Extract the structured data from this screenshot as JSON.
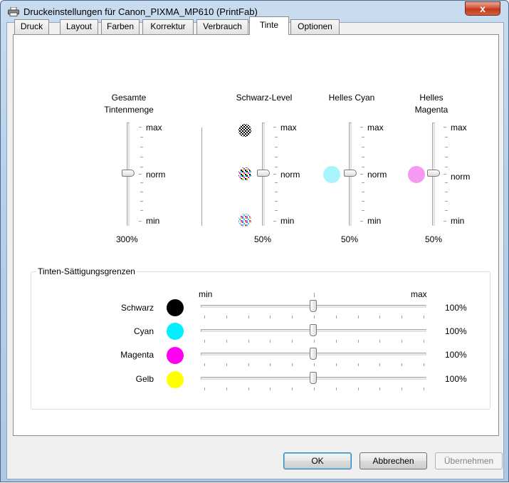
{
  "window": {
    "title": "Druckeinstellungen für Canon_PIXMA_MP610 (PrintFab)",
    "close_glyph": "x"
  },
  "tabs": [
    {
      "label": "Druck",
      "active": false
    },
    {
      "label": "Layout",
      "active": false
    },
    {
      "label": "Farben",
      "active": false
    },
    {
      "label": "Korrektur",
      "active": false
    },
    {
      "label": "Verbrauch",
      "active": false
    },
    {
      "label": "Tinte",
      "active": true
    },
    {
      "label": "Optionen",
      "active": false
    }
  ],
  "scale_labels": {
    "max": "max",
    "norm": "norm",
    "min": "min"
  },
  "vertical_sliders": [
    {
      "title_line1": "Gesamte",
      "title_line2": "Tintenmenge",
      "value_text": "300%",
      "level": 0.5
    },
    {
      "title_line1": "Schwarz-Level",
      "title_line2": "",
      "value_text": "50%",
      "level": 0.5
    },
    {
      "title_line1": "Helles Cyan",
      "title_line2": "",
      "value_text": "50%",
      "level": 0.5,
      "swatch_color": "#a8f4fc"
    },
    {
      "title_line1": "Helles",
      "title_line2": "Magenta",
      "value_text": "50%",
      "level": 0.5,
      "swatch_color": "#f59af0"
    }
  ],
  "saturation": {
    "title": "Tinten-Sättigungsgrenzen",
    "min_label": "min",
    "max_label": "max",
    "rows": [
      {
        "label": "Schwarz",
        "color": "#000000",
        "value_text": "100%",
        "level": 0.5
      },
      {
        "label": "Cyan",
        "color": "#00f0ff",
        "value_text": "100%",
        "level": 0.5
      },
      {
        "label": "Magenta",
        "color": "#ff00f0",
        "value_text": "100%",
        "level": 0.5
      },
      {
        "label": "Gelb",
        "color": "#ffff00",
        "value_text": "100%",
        "level": 0.5
      }
    ]
  },
  "buttons": {
    "ok": "OK",
    "cancel": "Abbrechen",
    "apply": "Übernehmen"
  },
  "icons": {
    "app": "printer-icon",
    "black_dither": "black-dither-icon",
    "cmy_dither": "color-dither-icon"
  }
}
